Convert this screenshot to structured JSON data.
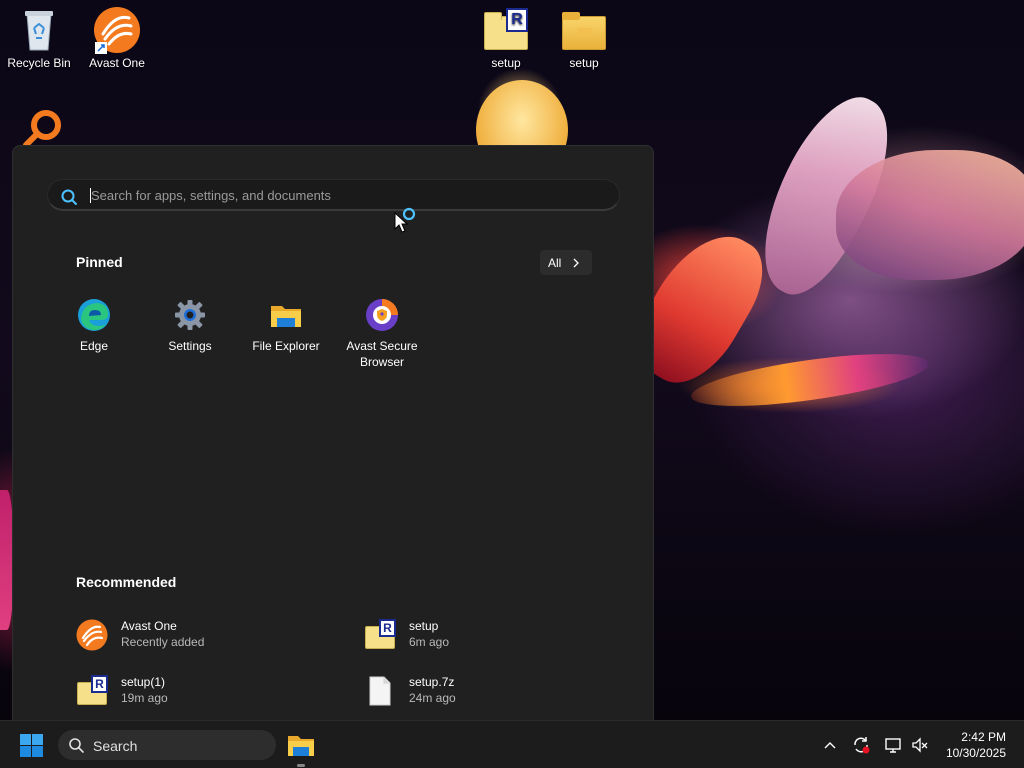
{
  "desktop": {
    "icons": [
      {
        "label": "Recycle Bin",
        "icon": "recycle-bin-icon"
      },
      {
        "label": "Avast One",
        "icon": "avast-one-icon"
      },
      {
        "label": "setup",
        "icon": "winrar-folder-icon"
      },
      {
        "label": "setup",
        "icon": "folder-icon"
      }
    ]
  },
  "start_menu": {
    "search": {
      "placeholder": "Search for apps, settings, and documents"
    },
    "pinned": {
      "title": "Pinned",
      "all_label": "All",
      "items": [
        {
          "label": "Edge",
          "icon": "edge-icon"
        },
        {
          "label": "Settings",
          "icon": "settings-gear-icon"
        },
        {
          "label": "File Explorer",
          "icon": "file-explorer-icon"
        },
        {
          "label": "Avast Secure Browser",
          "icon": "avast-secure-browser-icon"
        }
      ]
    },
    "recommended": {
      "title": "Recommended",
      "items": [
        {
          "name": "Avast One",
          "time": "Recently added",
          "icon": "avast-one-icon"
        },
        {
          "name": "setup",
          "time": "6m ago",
          "icon": "winrar-folder-icon"
        },
        {
          "name": "setup(1)",
          "time": "19m ago",
          "icon": "winrar-folder-icon"
        },
        {
          "name": "setup.7z",
          "time": "24m ago",
          "icon": "file-icon"
        }
      ]
    }
  },
  "taskbar": {
    "search_label": "Search",
    "clock": {
      "time": "2:42 PM",
      "date": "10/30/2025"
    }
  },
  "colors": {
    "accent": "#0078d4",
    "start_bg": "#202020",
    "taskbar_bg": "#1c1c1c",
    "avast_orange": "#f47a20",
    "folder_yellow": "#f8d775"
  }
}
